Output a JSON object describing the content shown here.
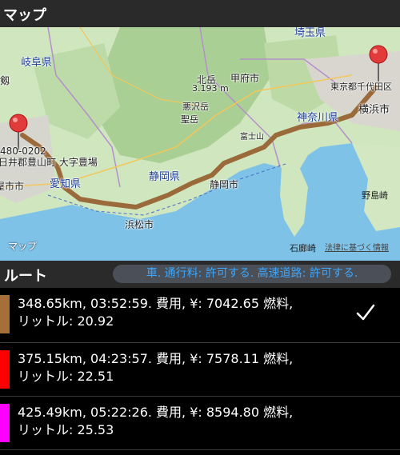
{
  "header": {
    "title": "マップ"
  },
  "map": {
    "labels": {
      "saitama": "埼玉県",
      "gifu": "岐阜県",
      "kitadake": "北岳",
      "kitadake_elev": "3.193 m",
      "kofu": "甲府市",
      "warusawadake": "悪沢岳",
      "hijiri": "聖岳",
      "tokyo": "東京都千代田区",
      "yokohama": "横浜市",
      "kanagawa": "神奈川県",
      "fuji": "富士山",
      "postal": "480-0202",
      "address": "西春日井郡豊山町 大字豊場",
      "nagoya": "屋市市",
      "aichi": "愛知県",
      "shizuoka_pref": "静岡県",
      "shizuoka_city": "静岡市",
      "hamamatsu": "浜松市",
      "nojimazaki": "野島崎",
      "irozaki": "石廊崎",
      "tsurugi": "剱"
    },
    "attribution": "マップ",
    "legal": "法律に基づく情報",
    "colors": {
      "route": "#9b6a3a",
      "sea": "#7fc2e8",
      "land": "#cfe6bf"
    }
  },
  "route_section": {
    "title": "ルート",
    "options": "車. 通行料: 許可する. 高速道路: 許可する."
  },
  "routes": [
    {
      "color": "#a66e38",
      "line1": "348.65km, 03:52:59. 費用, ¥: 7042.65 燃料,",
      "line2": "リットル: 20.92",
      "selected": true
    },
    {
      "color": "#ff0000",
      "line1": "375.15km, 04:23:57. 費用, ¥: 7578.11 燃料,",
      "line2": "リットル: 22.51",
      "selected": false
    },
    {
      "color": "#ff00ff",
      "line1": "425.49km, 05:22:26. 費用, ¥: 8594.80 燃料,",
      "line2": "リットル: 25.53",
      "selected": false
    }
  ]
}
